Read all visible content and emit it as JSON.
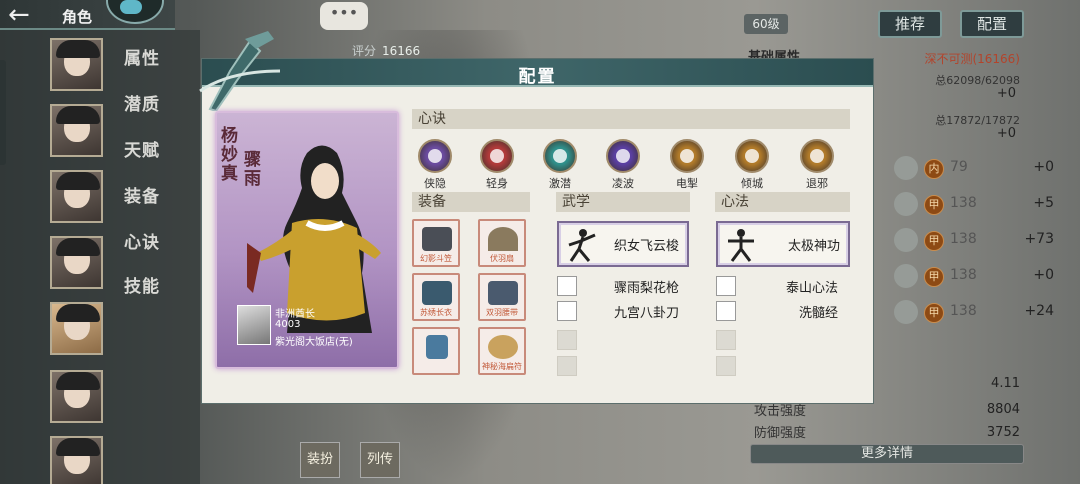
{
  "header": {
    "title": "角色",
    "back_icon": "back-arrow-icon"
  },
  "sidebar": {
    "tabs": [
      "属性",
      "潜质",
      "天赋",
      "装备",
      "心诀",
      "技能"
    ]
  },
  "top": {
    "score_label": "评分",
    "score_value": "16166",
    "chat_bubble": "•••"
  },
  "right": {
    "level": "60级",
    "recommend_button": "推荐",
    "config_button": "配置",
    "basic_attr_title": "基础属性",
    "rank_text": "深不可测(16166)",
    "hp_text": "总62098/62098",
    "hp_bonus": "+0",
    "mp_text": "总17872/17872",
    "mp_bonus": "+0",
    "stats": [
      {
        "badge": "内",
        "value": "79",
        "bonus": "+0"
      },
      {
        "badge": "甲",
        "value": "138",
        "bonus": "+5"
      },
      {
        "badge": "甲",
        "value": "138",
        "bonus": "+73"
      },
      {
        "badge": "甲",
        "value": "138",
        "bonus": "+0"
      },
      {
        "badge": "甲",
        "value": "138",
        "bonus": "+24"
      }
    ],
    "extra_value": "4.11",
    "attack_label": "攻击强度",
    "attack_value": "8804",
    "defense_label": "防御强度",
    "defense_value": "3752",
    "more_details": "更多详情"
  },
  "bottom_buttons": [
    "装扮",
    "列传"
  ],
  "dialog": {
    "title": "配置",
    "card": {
      "name_col1": "杨妙真",
      "name_col2": "骤雨",
      "owner_name": "非洲酋长",
      "owner_id": "4003",
      "owner_guild": "紫光阁大饭店(无)"
    },
    "xinjue_title": "心诀",
    "xinjue": [
      {
        "label": "侠隐",
        "color": "#6a4b9e",
        "icon": "swirl-icon"
      },
      {
        "label": "轻身",
        "color": "#b03a3a",
        "icon": "l-rune-icon"
      },
      {
        "label": "激潜",
        "color": "#2f8f8a",
        "icon": "vortex-icon"
      },
      {
        "label": "凌波",
        "color": "#5a3fa0",
        "icon": "wave-icon"
      },
      {
        "label": "电掣",
        "color": "#b07a2a",
        "icon": "l-rune-icon"
      },
      {
        "label": "倾城",
        "color": "#b07a2a",
        "icon": "crescent-icon"
      },
      {
        "label": "退邪",
        "color": "#b07a2a",
        "icon": "gate-icon"
      }
    ],
    "equip_title": "装备",
    "equipment": [
      {
        "label": "幻影斗笠",
        "color": "#4a4e56"
      },
      {
        "label": "伏羽扇",
        "color": "#8a7a5e"
      },
      {
        "label": "苏绣长衣",
        "color": "#3a5a6e"
      },
      {
        "label": "双羽腰带",
        "color": "#4a5a6e"
      },
      {
        "label": "",
        "color": "#4a7a9e"
      },
      {
        "label": "神秘海扁符",
        "color": "#c9a25e"
      }
    ],
    "martial_title": "武学",
    "martial_main": "织女飞云梭",
    "martial_list": [
      "骤雨梨花枪",
      "九宫八卦刀"
    ],
    "method_title": "心法",
    "method_main": "太极神功",
    "method_list": [
      "泰山心法",
      "洗髓经"
    ]
  }
}
